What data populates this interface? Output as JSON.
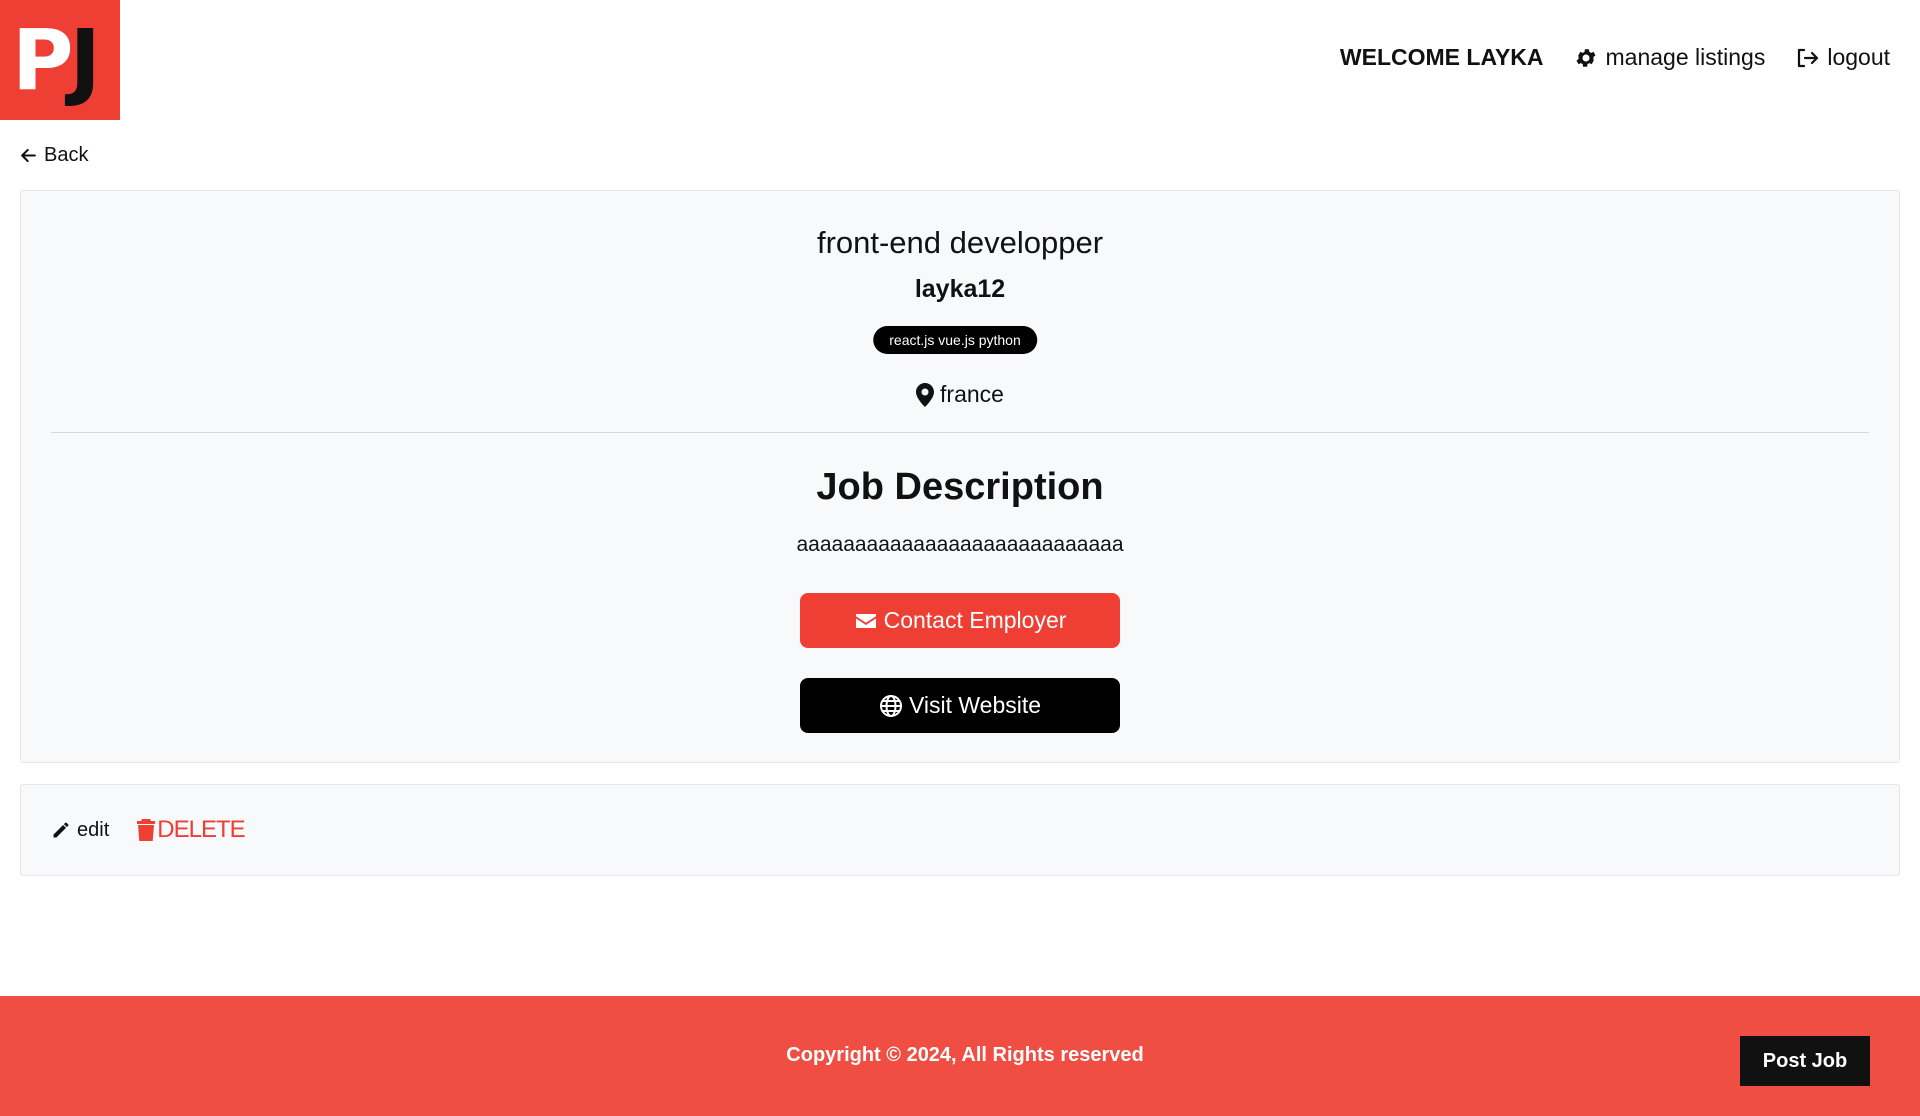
{
  "header": {
    "logo_p": "P",
    "logo_j": "J",
    "welcome": "WELCOME LAYKA",
    "manage_listings": "manage listings",
    "logout": "logout"
  },
  "back_label": "Back",
  "job": {
    "title": "front-end developper",
    "company": "layka12",
    "tags": "react.js vue.js python",
    "location": "france",
    "description_heading": "Job Description",
    "description": "aaaaaaaaaaaaaaaaaaaaaaaaaaaa",
    "contact_label": "Contact Employer",
    "website_label": "Visit Website"
  },
  "actions": {
    "edit_label": "edit",
    "delete_label": "DELETE"
  },
  "footer": {
    "copyright": "Copyright © 2024, All Rights reserved",
    "post_job_label": "Post Job"
  },
  "colors": {
    "accent": "#ef3e33",
    "footer": "#f04e42",
    "dark": "#000000"
  },
  "icons": {
    "manage": "gear-icon",
    "logout": "logout-icon",
    "back": "arrow-left-icon",
    "location": "map-pin-icon",
    "contact": "envelope-icon",
    "website": "globe-icon",
    "edit": "pencil-icon",
    "delete": "trash-icon"
  }
}
